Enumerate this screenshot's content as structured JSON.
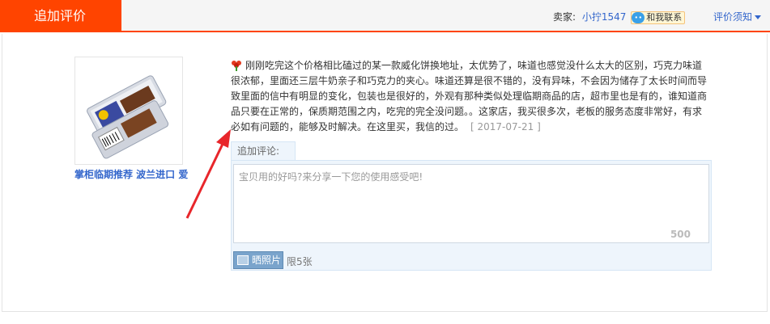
{
  "header": {
    "tab_title": "追加评价",
    "seller_label": "卖家:",
    "seller_name": "小拧1547",
    "contact_label": "和我联系",
    "notice_label": "评价须知"
  },
  "product": {
    "title": "掌柜临期推荐 波兰进口 爱"
  },
  "review": {
    "text": "刚刚吃完这个价格相比磕过的某一款威化饼换地址，太优势了，味道也感觉没什么太大的区别，巧克力味道很浓郁，里面还三层牛奶亲子和巧克力的夹心。味道还算是很不错的，没有异味，不会因为储存了太长时间而导致里面的信中有明显的变化，包装也是很好的，外观有那种类似处理临期商品的店，超市里也是有的，谁知道商品只要在正常的，保质期范围之内，吃完的完全没问题。。这家店，我买很多次，老板的服务态度非常好，有求必如有问题的，能够及时解决。在这里买，我信的过。",
    "date": "[ 2017-07-21 ]"
  },
  "comment": {
    "tab_label": "追加评论:",
    "placeholder": "宝贝用的好吗?来分享一下您的使用感受吧!",
    "counter": "500",
    "photo_button": "晒照片",
    "photo_limit": "限5张"
  },
  "colors": {
    "accent": "#ff4400",
    "link": "#3366cc"
  }
}
